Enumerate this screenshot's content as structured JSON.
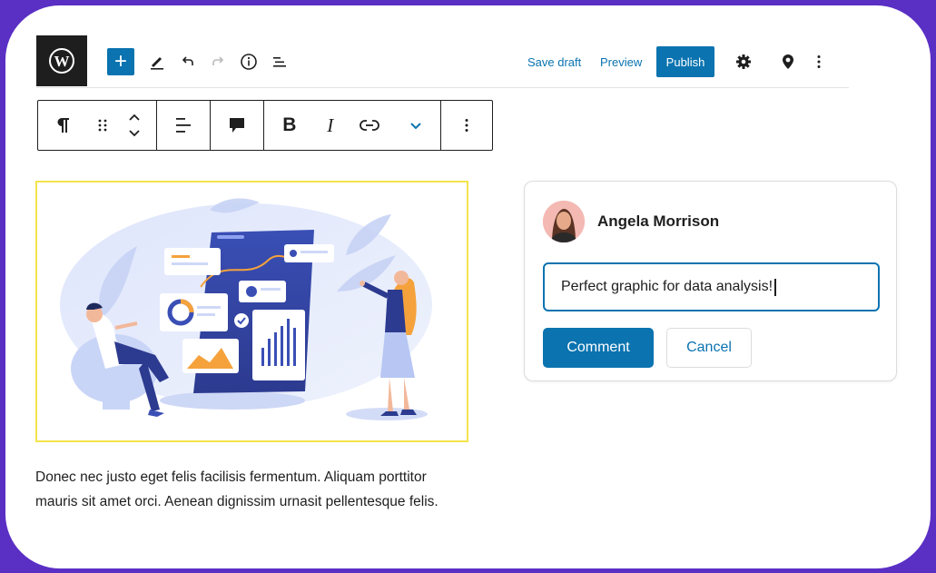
{
  "topbar": {
    "save_draft_label": "Save draft",
    "preview_label": "Preview",
    "publish_label": "Publish",
    "add_label": "+",
    "icons": [
      "wordpress-logo",
      "add-block",
      "edit-pencil",
      "undo",
      "redo",
      "info",
      "list-view",
      "settings-gear",
      "location-pin",
      "more-vertical"
    ]
  },
  "block_toolbar": {
    "bold_label": "B",
    "italic_label": "I",
    "icons": [
      "paragraph",
      "drag-handle",
      "move-up-down",
      "align",
      "comment",
      "bold",
      "italic",
      "link",
      "chevron-down",
      "more-vertical"
    ]
  },
  "content": {
    "paragraph": "Donec nec justo eget felis facilisis fermentum. Aliquam porttitor mauris sit amet orci. Aenean dignissim urnasit pellentesque felis."
  },
  "comment": {
    "author": "Angela Morrison",
    "input_value": "Perfect graphic for data analysis!",
    "submit_label": "Comment",
    "cancel_label": "Cancel"
  },
  "colors": {
    "accent": "#0a73b0",
    "frame": "#5a2fc4",
    "image_border": "#f3e44b"
  }
}
